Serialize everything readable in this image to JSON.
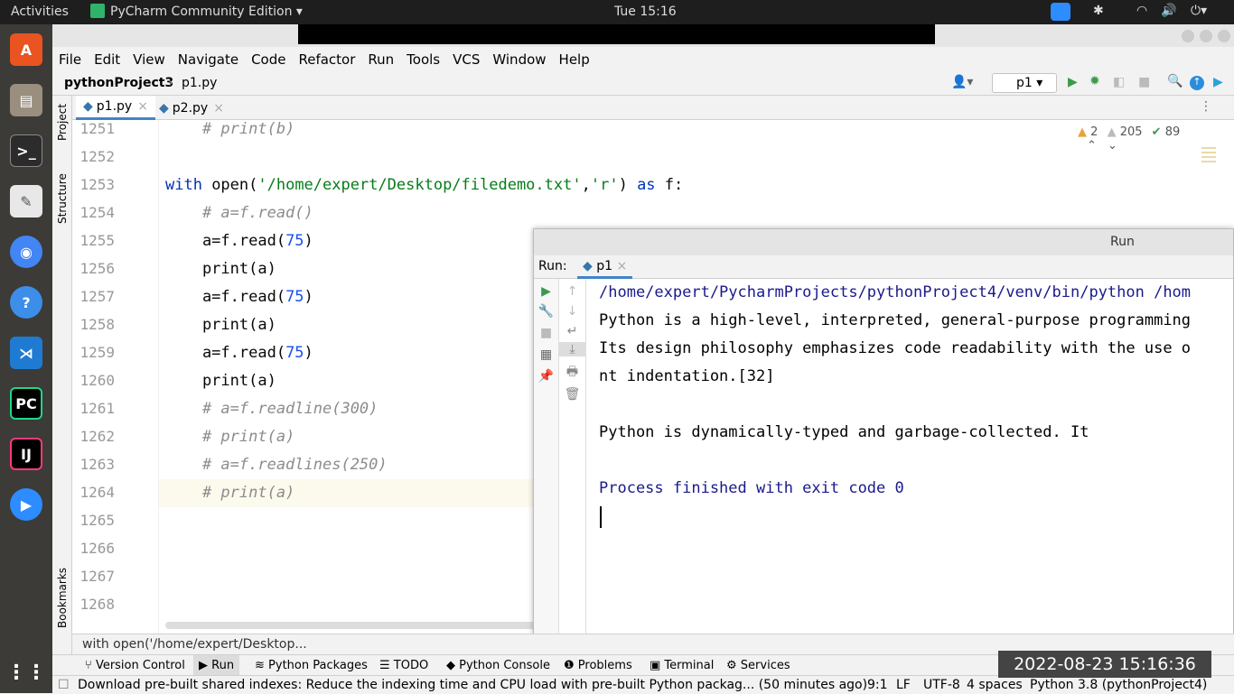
{
  "topbar": {
    "activities": "Activities",
    "app": "PyCharm Community Edition",
    "clock": "Tue 15:16"
  },
  "menu": [
    "File",
    "Edit",
    "View",
    "Navigate",
    "Code",
    "Refactor",
    "Run",
    "Tools",
    "VCS",
    "Window",
    "Help"
  ],
  "nav": {
    "project": "pythonProject3",
    "file": "p1.py",
    "run_config": "p1"
  },
  "tabs": [
    {
      "label": "p1.py"
    },
    {
      "label": "p2.py"
    }
  ],
  "side": {
    "project": "Project",
    "structure": "Structure",
    "bookmarks": "Bookmarks"
  },
  "inspections": {
    "warnings": "2",
    "weak": "205",
    "typos": "89"
  },
  "lines": [
    "1251",
    "1252",
    "1253",
    "1254",
    "1255",
    "1256",
    "1257",
    "1258",
    "1259",
    "1260",
    "1261",
    "1262",
    "1263",
    "1264",
    "1265",
    "1266",
    "1267",
    "1268"
  ],
  "code": {
    "l1251": "    # print(b)",
    "l1253a": "with ",
    "l1253b": "open(",
    "l1253c": "'/home/expert/Desktop/filedemo.txt'",
    "l1253d": ",",
    "l1253e": "'r'",
    "l1253f": ") ",
    "l1253g": "as",
    " l1253h": "",
    "l1253i": " f:",
    "l1254": "    # a=f.read()",
    "read_call": "    a=f.read(",
    "n75": "75",
    "close": ")",
    "print": "    print(a)",
    "l1261": "    # a=f.readline(300)",
    "l1262": "    # print(a)",
    "l1263": "    # a=f.readlines(250)",
    "l1264": "    # print(a)"
  },
  "run": {
    "title": "Run",
    "label": "Run:",
    "tab": "p1",
    "output": [
      "/home/expert/PycharmProjects/pythonProject4/venv/bin/python /hom",
      "Python is a high-level, interpreted, general-purpose programming",
      "Its design philosophy emphasizes code readability with the use o",
      "nt indentation.[32]",
      "",
      "Python is dynamically-typed and garbage-collected. It",
      "",
      "Process finished with exit code 0"
    ]
  },
  "breadcrumb": "with open('/home/expert/Desktop...",
  "tooltabs": [
    "Version Control",
    "Run",
    "Python Packages",
    "TODO",
    "Python Console",
    "Problems",
    "Terminal",
    "Services"
  ],
  "status": {
    "message": "Download pre-built shared indexes: Reduce the indexing time and CPU load with pre-built Python packag... (50 minutes ago)",
    "pos": "9:1",
    "le": "LF",
    "enc": "UTF-8",
    "indent": "4 spaces",
    "interp": "Python 3.8 (pythonProject4)"
  },
  "timestamp": "2022-08-23  15:16:36"
}
